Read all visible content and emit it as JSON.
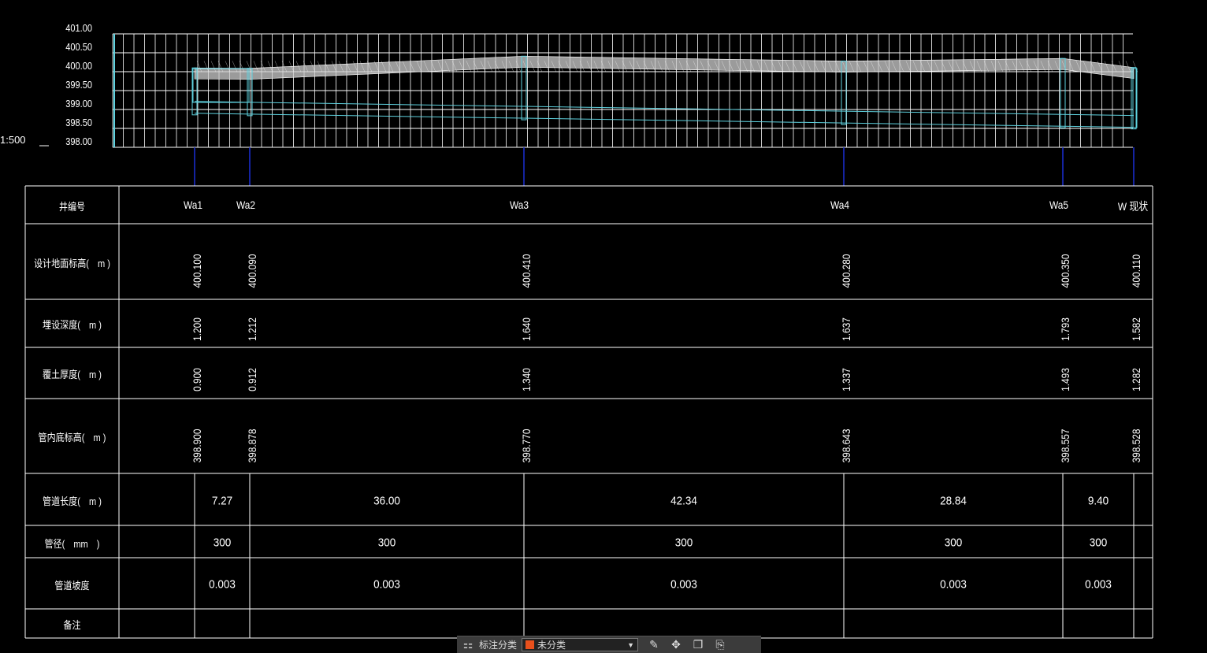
{
  "profile": {
    "scale_label": "1:500",
    "y_ticks": [
      "401.00",
      "400.50",
      "400.00",
      "399.50",
      "399.00",
      "398.50",
      "398.00"
    ]
  },
  "table": {
    "row_labels": {
      "well_no": "井编号",
      "ground_elev": "设计地面标高(　m )",
      "burial_depth": "埋设深度(　m )",
      "cover_depth": "覆土厚度(　m )",
      "invert_elev": "管内底标高(　m )",
      "pipe_length": "管道长度(　m )",
      "pipe_diameter": "管径(　mm　)",
      "pipe_slope": "管道坡度",
      "remarks": "备注"
    },
    "wells": [
      {
        "name": "Wa1",
        "ground": "400.100",
        "burial": "1.200",
        "cover": "0.900",
        "invert": "398.900"
      },
      {
        "name": "Wa2",
        "ground": "400.090",
        "burial": "1.212",
        "cover": "0.912",
        "invert": "398.878"
      },
      {
        "name": "Wa3",
        "ground": "400.410",
        "burial": "1.640",
        "cover": "1.340",
        "invert": "398.770"
      },
      {
        "name": "Wa4",
        "ground": "400.280",
        "burial": "1.637",
        "cover": "1.337",
        "invert": "398.643"
      },
      {
        "name": "Wa5",
        "ground": "400.350",
        "burial": "1.793",
        "cover": "1.493",
        "invert": "398.557"
      },
      {
        "name": "W 现状",
        "ground": "400.110",
        "burial": "1.582",
        "cover": "1.282",
        "invert": "398.528"
      }
    ],
    "segments": [
      {
        "length": "7.27",
        "diameter": "300",
        "slope": "0.003"
      },
      {
        "length": "36.00",
        "diameter": "300",
        "slope": "0.003"
      },
      {
        "length": "42.34",
        "diameter": "300",
        "slope": "0.003"
      },
      {
        "length": "28.84",
        "diameter": "300",
        "slope": "0.003"
      },
      {
        "length": "9.40",
        "diameter": "300",
        "slope": "0.003"
      }
    ]
  },
  "toolbar": {
    "label": "标注分类",
    "selected": "未分类",
    "swatch_color": "#e8501c"
  },
  "colors": {
    "grid": "#ffffff",
    "pipe": "#5fd3e0",
    "well_line": "#1a2fd6",
    "text": "#ffffff"
  }
}
